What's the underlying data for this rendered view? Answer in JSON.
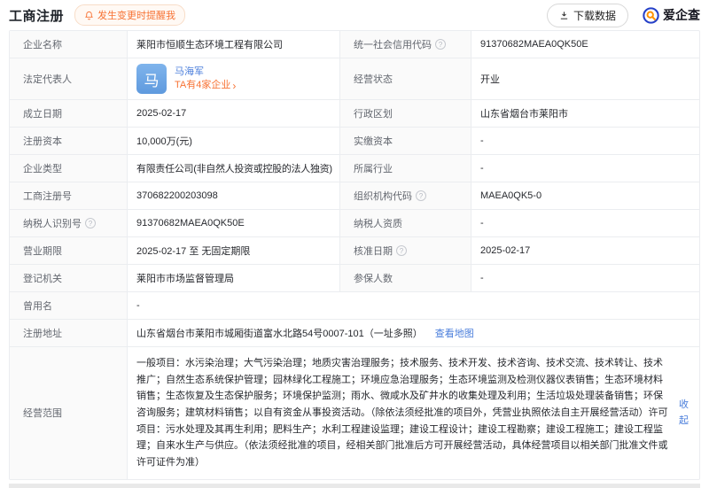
{
  "header": {
    "title": "工商注册",
    "reminder": "发生变更时提醒我",
    "download": "下载数据",
    "brand": "爱企查"
  },
  "icons": {
    "help": "?",
    "chevron": "›"
  },
  "colors": {
    "accent_orange": "#f77234",
    "link_blue": "#4a7edb",
    "avatar_blue": "#6ca4e4",
    "brand_blue": "#2540c8",
    "brand_orange": "#ff9100",
    "label_bg": "#fafafa",
    "border": "#ebedf0"
  },
  "registration": {
    "company_name": {
      "label": "企业名称",
      "value": "莱阳市恒顺生态环境工程有限公司"
    },
    "credit_code": {
      "label": "统一社会信用代码",
      "value": "91370682MAEA0QK50E"
    },
    "legal_rep": {
      "label": "法定代表人",
      "name": "马海军",
      "avatar": "马",
      "related": "TA有4家企业"
    },
    "status": {
      "label": "经营状态",
      "value": "开业"
    },
    "establish_date": {
      "label": "成立日期",
      "value": "2025-02-17"
    },
    "district": {
      "label": "行政区划",
      "value": "山东省烟台市莱阳市"
    },
    "reg_capital": {
      "label": "注册资本",
      "value": "10,000万(元)"
    },
    "paid_capital": {
      "label": "实缴资本",
      "value": "-"
    },
    "company_type": {
      "label": "企业类型",
      "value": "有限责任公司(非自然人投资或控股的法人独资)"
    },
    "industry": {
      "label": "所属行业",
      "value": "-"
    },
    "reg_number": {
      "label": "工商注册号",
      "value": "370682200203098"
    },
    "org_code": {
      "label": "组织机构代码",
      "value": "MAEA0QK5-0"
    },
    "taxpayer_id": {
      "label": "纳税人识别号",
      "value": "91370682MAEA0QK50E"
    },
    "taxpayer_qualification": {
      "label": "纳税人资质",
      "value": "-"
    },
    "business_term": {
      "label": "营业期限",
      "value": "2025-02-17 至 无固定期限"
    },
    "approval_date": {
      "label": "核准日期",
      "value": "2025-02-17"
    },
    "reg_authority": {
      "label": "登记机关",
      "value": "莱阳市市场监督管理局"
    },
    "insured_count": {
      "label": "参保人数",
      "value": "-"
    },
    "former_name": {
      "label": "曾用名",
      "value": "-"
    },
    "address": {
      "label": "注册地址",
      "value": "山东省烟台市莱阳市城厢街道富水北路54号0007-101（一址多照）",
      "map_link": "查看地图"
    },
    "business_scope": {
      "label": "经营范围",
      "value": "一般项目：水污染治理；大气污染治理；地质灾害治理服务；技术服务、技术开发、技术咨询、技术交流、技术转让、技术推广；自然生态系统保护管理；园林绿化工程施工；环境应急治理服务；生态环境监测及检测仪器仪表销售；生态环境材料销售；生态恢复及生态保护服务；环境保护监测；雨水、微咸水及矿井水的收集处理及利用；生活垃圾处理装备销售；环保咨询服务；建筑材料销售；以自有资金从事投资活动。（除依法须经批准的项目外，凭营业执照依法自主开展经营活动）许可项目：污水处理及其再生利用；肥料生产；水利工程建设监理；建设工程设计；建设工程勘察；建设工程施工；建设工程监理；自来水生产与供应。（依法须经批准的项目，经相关部门批准后方可开展经营活动，具体经营项目以相关部门批准文件或许可证件为准）",
      "collapse_link": "收起"
    }
  }
}
